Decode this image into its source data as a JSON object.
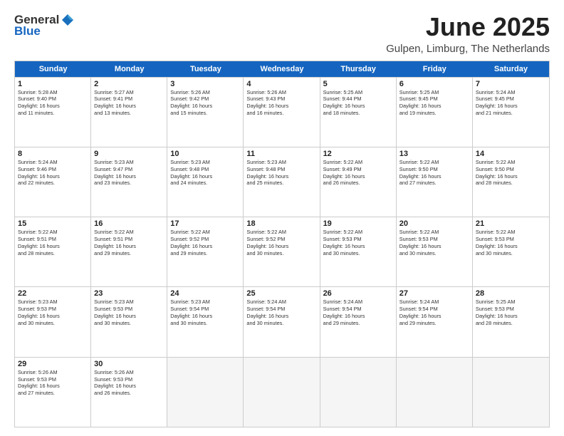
{
  "logo": {
    "general": "General",
    "blue": "Blue"
  },
  "title": {
    "month": "June 2025",
    "location": "Gulpen, Limburg, The Netherlands"
  },
  "header": {
    "days": [
      "Sunday",
      "Monday",
      "Tuesday",
      "Wednesday",
      "Thursday",
      "Friday",
      "Saturday"
    ]
  },
  "rows": [
    [
      {
        "day": "1",
        "lines": [
          "Sunrise: 5:28 AM",
          "Sunset: 9:40 PM",
          "Daylight: 16 hours",
          "and 11 minutes."
        ]
      },
      {
        "day": "2",
        "lines": [
          "Sunrise: 5:27 AM",
          "Sunset: 9:41 PM",
          "Daylight: 16 hours",
          "and 13 minutes."
        ]
      },
      {
        "day": "3",
        "lines": [
          "Sunrise: 5:26 AM",
          "Sunset: 9:42 PM",
          "Daylight: 16 hours",
          "and 15 minutes."
        ]
      },
      {
        "day": "4",
        "lines": [
          "Sunrise: 5:26 AM",
          "Sunset: 9:43 PM",
          "Daylight: 16 hours",
          "and 16 minutes."
        ]
      },
      {
        "day": "5",
        "lines": [
          "Sunrise: 5:25 AM",
          "Sunset: 9:44 PM",
          "Daylight: 16 hours",
          "and 18 minutes."
        ]
      },
      {
        "day": "6",
        "lines": [
          "Sunrise: 5:25 AM",
          "Sunset: 9:45 PM",
          "Daylight: 16 hours",
          "and 19 minutes."
        ]
      },
      {
        "day": "7",
        "lines": [
          "Sunrise: 5:24 AM",
          "Sunset: 9:45 PM",
          "Daylight: 16 hours",
          "and 21 minutes."
        ]
      }
    ],
    [
      {
        "day": "8",
        "lines": [
          "Sunrise: 5:24 AM",
          "Sunset: 9:46 PM",
          "Daylight: 16 hours",
          "and 22 minutes."
        ]
      },
      {
        "day": "9",
        "lines": [
          "Sunrise: 5:23 AM",
          "Sunset: 9:47 PM",
          "Daylight: 16 hours",
          "and 23 minutes."
        ]
      },
      {
        "day": "10",
        "lines": [
          "Sunrise: 5:23 AM",
          "Sunset: 9:48 PM",
          "Daylight: 16 hours",
          "and 24 minutes."
        ]
      },
      {
        "day": "11",
        "lines": [
          "Sunrise: 5:23 AM",
          "Sunset: 9:48 PM",
          "Daylight: 16 hours",
          "and 25 minutes."
        ]
      },
      {
        "day": "12",
        "lines": [
          "Sunrise: 5:22 AM",
          "Sunset: 9:49 PM",
          "Daylight: 16 hours",
          "and 26 minutes."
        ]
      },
      {
        "day": "13",
        "lines": [
          "Sunrise: 5:22 AM",
          "Sunset: 9:50 PM",
          "Daylight: 16 hours",
          "and 27 minutes."
        ]
      },
      {
        "day": "14",
        "lines": [
          "Sunrise: 5:22 AM",
          "Sunset: 9:50 PM",
          "Daylight: 16 hours",
          "and 28 minutes."
        ]
      }
    ],
    [
      {
        "day": "15",
        "lines": [
          "Sunrise: 5:22 AM",
          "Sunset: 9:51 PM",
          "Daylight: 16 hours",
          "and 28 minutes."
        ]
      },
      {
        "day": "16",
        "lines": [
          "Sunrise: 5:22 AM",
          "Sunset: 9:51 PM",
          "Daylight: 16 hours",
          "and 29 minutes."
        ]
      },
      {
        "day": "17",
        "lines": [
          "Sunrise: 5:22 AM",
          "Sunset: 9:52 PM",
          "Daylight: 16 hours",
          "and 29 minutes."
        ]
      },
      {
        "day": "18",
        "lines": [
          "Sunrise: 5:22 AM",
          "Sunset: 9:52 PM",
          "Daylight: 16 hours",
          "and 30 minutes."
        ]
      },
      {
        "day": "19",
        "lines": [
          "Sunrise: 5:22 AM",
          "Sunset: 9:53 PM",
          "Daylight: 16 hours",
          "and 30 minutes."
        ]
      },
      {
        "day": "20",
        "lines": [
          "Sunrise: 5:22 AM",
          "Sunset: 9:53 PM",
          "Daylight: 16 hours",
          "and 30 minutes."
        ]
      },
      {
        "day": "21",
        "lines": [
          "Sunrise: 5:22 AM",
          "Sunset: 9:53 PM",
          "Daylight: 16 hours",
          "and 30 minutes."
        ]
      }
    ],
    [
      {
        "day": "22",
        "lines": [
          "Sunrise: 5:23 AM",
          "Sunset: 9:53 PM",
          "Daylight: 16 hours",
          "and 30 minutes."
        ]
      },
      {
        "day": "23",
        "lines": [
          "Sunrise: 5:23 AM",
          "Sunset: 9:53 PM",
          "Daylight: 16 hours",
          "and 30 minutes."
        ]
      },
      {
        "day": "24",
        "lines": [
          "Sunrise: 5:23 AM",
          "Sunset: 9:54 PM",
          "Daylight: 16 hours",
          "and 30 minutes."
        ]
      },
      {
        "day": "25",
        "lines": [
          "Sunrise: 5:24 AM",
          "Sunset: 9:54 PM",
          "Daylight: 16 hours",
          "and 30 minutes."
        ]
      },
      {
        "day": "26",
        "lines": [
          "Sunrise: 5:24 AM",
          "Sunset: 9:54 PM",
          "Daylight: 16 hours",
          "and 29 minutes."
        ]
      },
      {
        "day": "27",
        "lines": [
          "Sunrise: 5:24 AM",
          "Sunset: 9:54 PM",
          "Daylight: 16 hours",
          "and 29 minutes."
        ]
      },
      {
        "day": "28",
        "lines": [
          "Sunrise: 5:25 AM",
          "Sunset: 9:53 PM",
          "Daylight: 16 hours",
          "and 28 minutes."
        ]
      }
    ],
    [
      {
        "day": "29",
        "lines": [
          "Sunrise: 5:26 AM",
          "Sunset: 9:53 PM",
          "Daylight: 16 hours",
          "and 27 minutes."
        ]
      },
      {
        "day": "30",
        "lines": [
          "Sunrise: 5:26 AM",
          "Sunset: 9:53 PM",
          "Daylight: 16 hours",
          "and 26 minutes."
        ]
      },
      {
        "day": "",
        "lines": []
      },
      {
        "day": "",
        "lines": []
      },
      {
        "day": "",
        "lines": []
      },
      {
        "day": "",
        "lines": []
      },
      {
        "day": "",
        "lines": []
      }
    ]
  ]
}
